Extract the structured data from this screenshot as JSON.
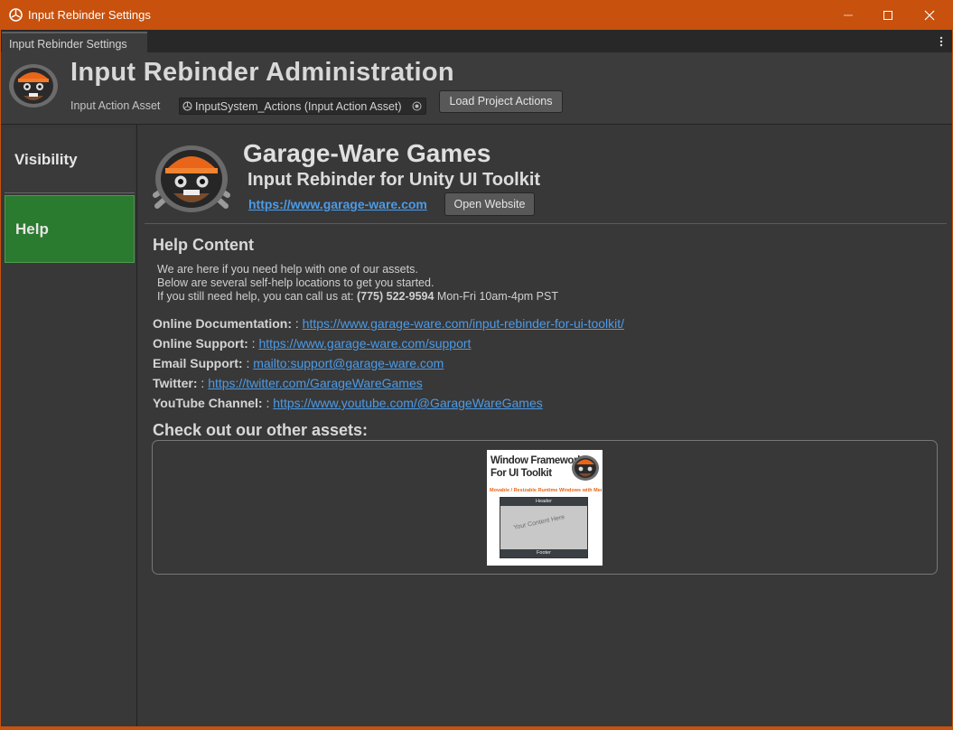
{
  "window": {
    "title": "Input Rebinder Settings"
  },
  "tab": {
    "label": "Input Rebinder Settings"
  },
  "header": {
    "title": "Input Rebinder Administration",
    "asset_label": "Input Action Asset",
    "asset_value": "InputSystem_Actions (Input Action Asset)",
    "load_button": "Load Project Actions"
  },
  "sidebar": {
    "items": [
      {
        "label": "Visibility",
        "selected": false
      },
      {
        "label": "Help",
        "selected": true
      }
    ]
  },
  "main": {
    "title": "Garage-Ware Games",
    "subtitle": "Input Rebinder for Unity UI Toolkit",
    "website": "https://www.garage-ware.com",
    "open_website_button": "Open Website",
    "help_heading": "Help Content",
    "help_line1": "We are here if you need help with one of our assets.",
    "help_line2": "Below are several self-help locations to get you started.",
    "help_line3_prefix": "If you still need help, you can call us at: ",
    "phone": "(775) 522-9594",
    "help_line3_suffix": " Mon-Fri 10am-4pm PST",
    "contacts": [
      {
        "label": "Online Documentation:",
        "sep": " : ",
        "url": "https://www.garage-ware.com/input-rebinder-for-ui-toolkit/"
      },
      {
        "label": "Online Support:",
        "sep": " : ",
        "url": "https://www.garage-ware.com/support"
      },
      {
        "label": "Email Support:",
        "sep": " : ",
        "url": "mailto:support@garage-ware.com"
      },
      {
        "label": "Twitter:",
        "sep": " : ",
        "url": "https://twitter.com/GarageWareGames"
      },
      {
        "label": "YouTube Channel:",
        "sep": " : ",
        "url": "https://www.youtube.com/@GarageWareGames"
      }
    ],
    "assets_heading": "Check out our other assets:",
    "asset_thumb": {
      "title_line1": "Window Framework",
      "title_line2": "For UI Toolkit",
      "tagline": "Movable / Resizable Runtime Windows with Memory",
      "header_label": "Header",
      "content_label": "Your Content Here",
      "footer_label": "Footer"
    }
  },
  "colors": {
    "titlebar": "#c8510d",
    "help_selected": "#2a7a2f",
    "link": "#4c9be8",
    "orange_accent": "#e8651a"
  }
}
